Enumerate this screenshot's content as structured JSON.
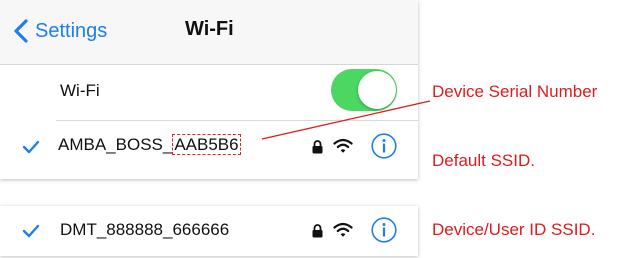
{
  "navbar": {
    "back_label": "Settings",
    "title": "Wi-Fi"
  },
  "wifi_toggle": {
    "label": "Wi-Fi",
    "enabled": true
  },
  "networks": [
    {
      "name_prefix": "AMBA_BOSS_",
      "name_suffix": "AAB5B6",
      "connected": true,
      "secured": true
    },
    {
      "name": "DMT_888888_666666",
      "connected": true,
      "secured": true
    }
  ],
  "annotations": {
    "serial": "Device Serial Number",
    "default_ssid": "Default SSID.",
    "user_ssid": "Device/User ID SSID."
  },
  "colors": {
    "accent": "#1c7ef1",
    "toggle_on": "#4bd762",
    "annotation": "#e01b1b"
  },
  "icons": [
    "chevron-left-icon",
    "checkmark-icon",
    "lock-icon",
    "wifi-icon",
    "info-icon"
  ]
}
